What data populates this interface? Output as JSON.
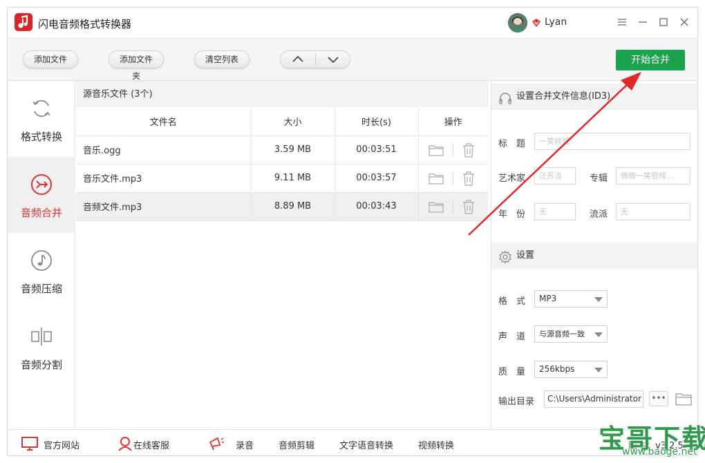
{
  "app": {
    "title": "闪电音频格式转换器",
    "username": "Lyan"
  },
  "toolbar": {
    "add_file": "添加文件",
    "add_folder": "添加文件夹",
    "clear_list": "清空列表",
    "start_merge": "开始合并"
  },
  "sidebar": {
    "items": [
      {
        "label": "格式转换",
        "icon": "refresh-icon",
        "active": false
      },
      {
        "label": "音频合并",
        "icon": "merge-icon",
        "active": true
      },
      {
        "label": "音频压缩",
        "icon": "music-note-icon",
        "active": false
      },
      {
        "label": "音频分割",
        "icon": "split-icon",
        "active": false
      }
    ]
  },
  "list": {
    "header": "源音乐文件 (3个)",
    "columns": [
      "文件名",
      "大小",
      "时长(s)",
      "操作"
    ],
    "rows": [
      {
        "name": "音乐.ogg",
        "size": "3.59 MB",
        "duration": "00:03:51"
      },
      {
        "name": "音乐文件.mp3",
        "size": "9.11 MB",
        "duration": "00:03:57"
      },
      {
        "name": "音频文件.mp3",
        "size": "8.89 MB",
        "duration": "00:03:43"
      }
    ]
  },
  "id3": {
    "heading": "设置合并文件信息(ID3)",
    "title_label": "标　题",
    "title_placeholder": "一笑倾城",
    "artist_label": "艺术家",
    "artist_placeholder": "汪苏泷",
    "album_label": "专辑",
    "album_placeholder": "微微一笑很倾...",
    "year_label": "年　份",
    "year_placeholder": "无",
    "genre_label": "流派",
    "genre_placeholder": "无"
  },
  "settings": {
    "heading": "设置",
    "format_label": "格　式",
    "format_value": "MP3",
    "channel_label": "声　道",
    "channel_value": "与源音频一致",
    "quality_label": "质　量",
    "quality_value": "256kbps",
    "output_label": "输出目录",
    "output_value": "C:\\Users\\Administrator",
    "more_label": "•••"
  },
  "footer": {
    "website": "官方网站",
    "support": "在线客服",
    "record": "录音",
    "audio_edit": "音频剪辑",
    "tts": "文字语音转换",
    "video": "视频转换",
    "version": "版本：v3.2.5"
  },
  "watermark": {
    "text": "宝哥下载",
    "url": "www.baoge.net"
  },
  "colors": {
    "accent_red": "#e03232",
    "start_green": "#1ba24c",
    "watermark_green": "#2f9a4c"
  }
}
